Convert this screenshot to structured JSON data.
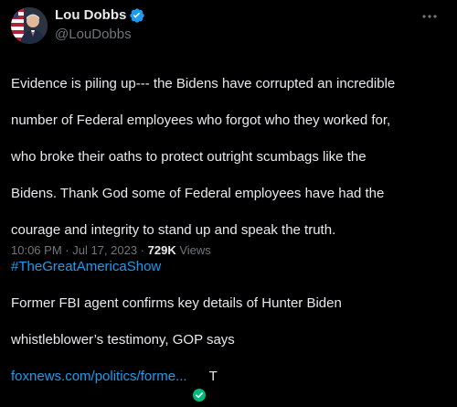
{
  "author": {
    "display_name": "Lou Dobbs",
    "handle": "@LouDobbs",
    "verified_color": "#1d9bf0"
  },
  "tweet": {
    "text_lines": [
      "Evidence is piling up--- the Bidens have corrupted an incredible",
      "number of Federal employees who forgot who they worked for,",
      "who broke their oaths to protect outright scumbags like the",
      "Bidens. Thank God some of Federal employees have had the",
      "courage and integrity to stand up and speak the truth."
    ],
    "hashtag": "#TheGreatAmericaShow",
    "headline_lines": [
      "Former FBI agent confirms key details of Hunter Biden",
      "whistleblower’s testimony, GOP says"
    ],
    "link_text": "foxnews.com/politics/forme...",
    "link_trailing": "T"
  },
  "meta": {
    "time": "10:06 PM",
    "separator": " · ",
    "date": "Jul 17, 2023",
    "views_count": "729K",
    "views_label": " Views"
  },
  "colors": {
    "background": "#000000",
    "text": "#e7e9ea",
    "secondary": "#71767b",
    "link": "#1d9bf0",
    "badge_green": "#00ba7c"
  },
  "icons": {
    "avatar": "profile-photo",
    "verified": "verified-badge-icon",
    "more": "more-options-icon",
    "check": "green-check-icon"
  }
}
